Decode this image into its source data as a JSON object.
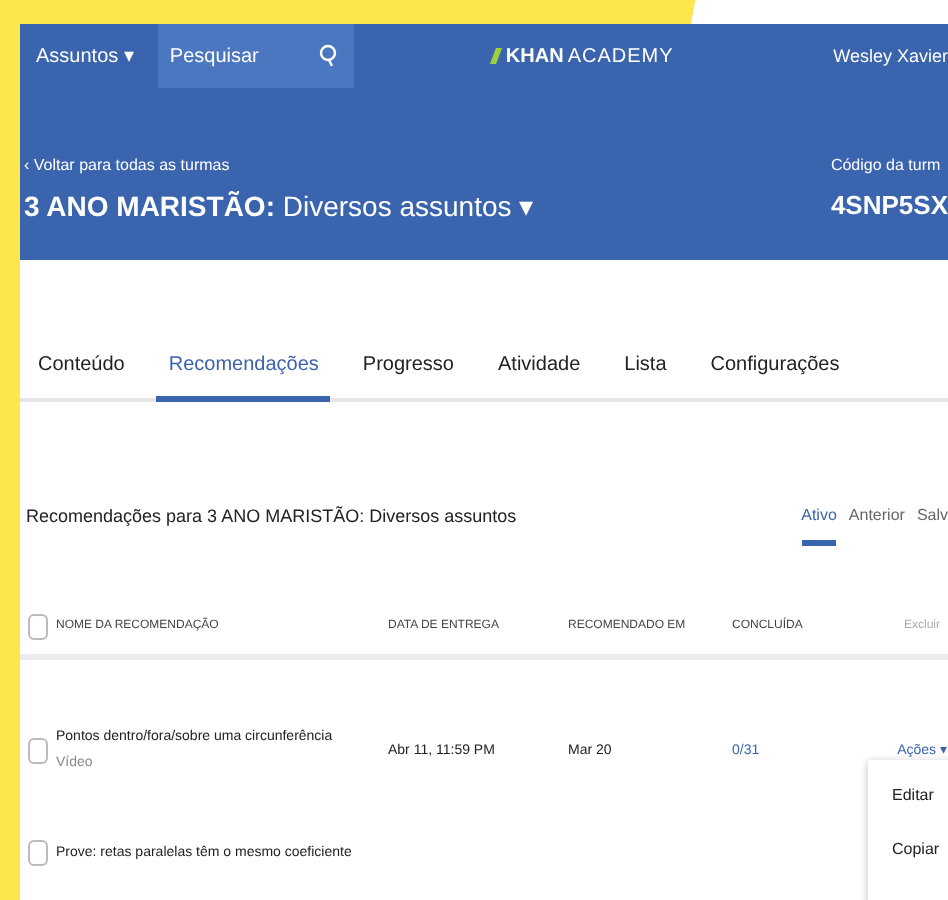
{
  "topbar": {
    "subjects_menu": "Assuntos ▾",
    "search": {
      "placeholder": "Pesquisar"
    },
    "logo": {
      "bold": "KHAN",
      "light": "ACADEMY"
    },
    "user": "Wesley Xavier"
  },
  "header": {
    "back_link": "‹ Voltar para todas as turmas",
    "class_title": {
      "bold": "3 ANO MARISTÃO:",
      "rest": "Diversos assuntos ▾"
    },
    "code_label": "Código da turm",
    "code": "4SNP5SX"
  },
  "tabs": [
    {
      "label": "Conteúdo",
      "selected": false
    },
    {
      "label": "Recomendações",
      "selected": true
    },
    {
      "label": "Progresso",
      "selected": false
    },
    {
      "label": "Atividade",
      "selected": false
    },
    {
      "label": "Lista",
      "selected": false
    },
    {
      "label": "Configurações",
      "selected": false
    }
  ],
  "section_title": "Recomendações para 3 ANO MARISTÃO: Diversos assuntos",
  "filters": [
    {
      "label": "Ativo",
      "selected": true
    },
    {
      "label": "Anterior",
      "selected": false
    },
    {
      "label": "Salv",
      "selected": false
    }
  ],
  "table": {
    "select_all_checked": false,
    "columns": [
      "NOME DA RECOMENDAÇÃO",
      "DATA DE ENTREGA",
      "RECOMENDADO EM",
      "CONCLUÍDA",
      "Excluir"
    ],
    "rows": [
      {
        "checked": false,
        "name": "Pontos dentro/fora/sobre uma circunferência",
        "type": "Vídeo",
        "due": "Abr 11, 11:59 PM",
        "recommended": "Mar 20",
        "completed": "0/31",
        "action": "Ações ▾"
      },
      {
        "checked": false,
        "name": "Prove: retas paralelas têm o mesmo coeficiente"
      }
    ]
  },
  "action_menu": [
    "Editar",
    "Copiar"
  ]
}
